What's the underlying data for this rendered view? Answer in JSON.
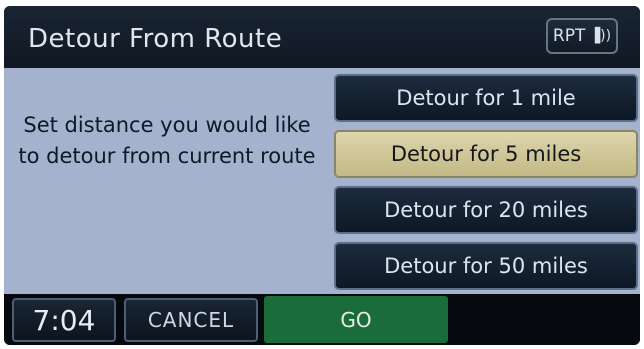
{
  "header": {
    "title": "Detour From Route",
    "rpt_label": "RPT",
    "rpt_icon": "speaker-waves-icon"
  },
  "instruction": "Set distance you would like to detour from current route",
  "options": [
    {
      "label": "Detour for 1 mile",
      "selected": false
    },
    {
      "label": "Detour for 5 miles",
      "selected": true
    },
    {
      "label": "Detour for 20 miles",
      "selected": false
    },
    {
      "label": "Detour for 50 miles",
      "selected": false
    }
  ],
  "bottom_bar": {
    "clock": "7:04",
    "cancel_label": "CANCEL",
    "go_label": "GO"
  },
  "colors": {
    "selected_option": "#d3cb9c",
    "go_button": "#1a6d3a",
    "panel_background": "#a4b2cd"
  }
}
